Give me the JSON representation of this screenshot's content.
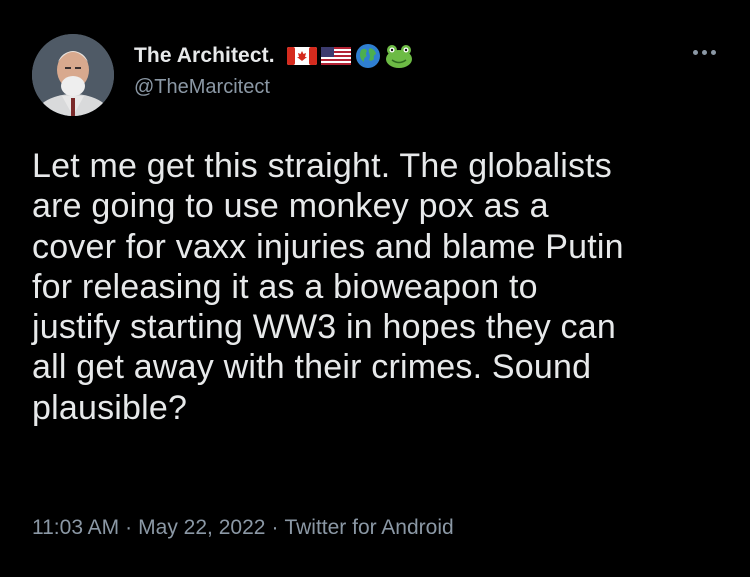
{
  "author": {
    "display_name": "The Architect.",
    "handle": "@TheMarcitect",
    "name_emojis": [
      "flag-canada-icon",
      "flag-usa-icon",
      "globe-icon",
      "frog-icon"
    ]
  },
  "tweet": {
    "text": "Let me get this straight. The globalists\nare going to use monkey pox as a\ncover for vaxx injuries and blame Putin\nfor releasing it as a bioweapon to\njustify starting WW3 in hopes they can\nall get away with their crimes. Sound\nplausible?",
    "time": "11:03 AM",
    "date": "May 22, 2022",
    "source": "Twitter for Android",
    "separator": "·"
  },
  "colors": {
    "background": "#000000",
    "text": "#e7e9ea",
    "secondary_text": "#8b98a5"
  }
}
